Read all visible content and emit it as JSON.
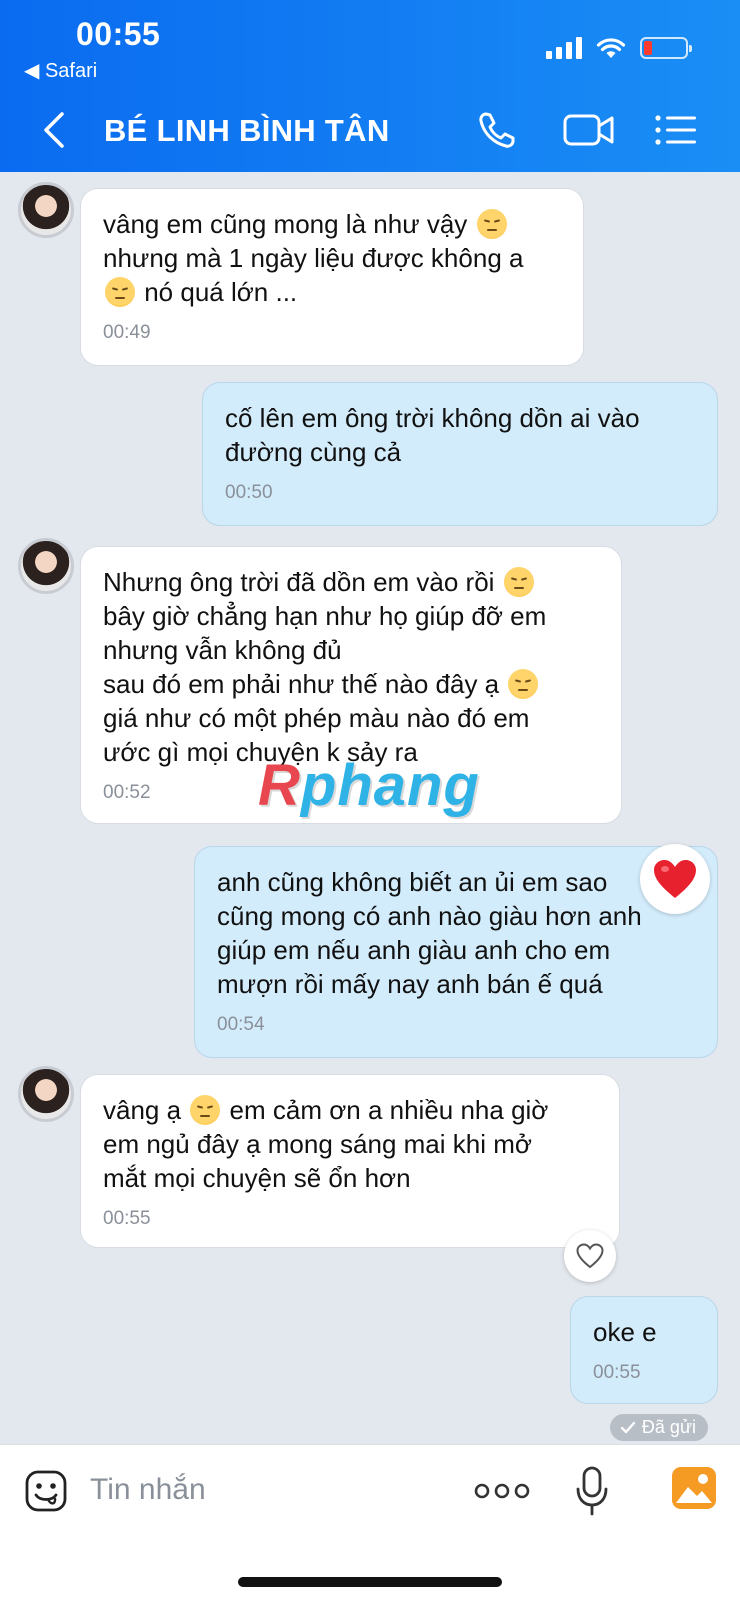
{
  "status_bar": {
    "time": "00:55",
    "back_app": "◀ Safari"
  },
  "header": {
    "contact_name": "BÉ LINH BÌNH TÂN",
    "icons": [
      "back-chevron-icon",
      "phone-icon",
      "video-call-icon",
      "menu-list-icon"
    ]
  },
  "messages": [
    {
      "direction": "in",
      "parts": [
        "vâng em cũng mong là như vậy ",
        "😔",
        "\nnhưng mà 1 ngày liệu được không a\n",
        "😔",
        " nó quá lớn ..."
      ],
      "time": "00:49"
    },
    {
      "direction": "out",
      "parts": [
        "cố lên em ông trời không dồn ai vào\nđường cùng cả"
      ],
      "time": "00:50"
    },
    {
      "direction": "in",
      "parts": [
        "Nhưng ông trời đã dồn em vào rồi ",
        "😔",
        "\nbây giờ chẳng hạn như họ giúp đỡ em\nnhưng vẫn không đủ\nsau đó em phải như thế nào đây ạ ",
        "😔",
        "\ngiá như có một phép màu nào đó em\nước gì mọi chuyện k sảy ra"
      ],
      "time": "00:52"
    },
    {
      "direction": "out",
      "parts": [
        "anh cũng không biết an ủi em sao\ncũng mong có anh nào giàu hơn anh\ngiúp em nếu anh giàu anh cho em\nmượn rồi mấy nay anh bán ế quá"
      ],
      "time": "00:54",
      "reaction": "heart-red"
    },
    {
      "direction": "in",
      "parts": [
        "vâng ạ ",
        "😔",
        " em cảm ơn a nhiều nha giờ\nem ngủ đây ạ mong sáng mai khi mở\nmắt mọi chuyện sẽ ổn hơn"
      ],
      "time": "00:55",
      "reaction": "heart-outline"
    },
    {
      "direction": "out",
      "parts": [
        "oke e"
      ],
      "time": "00:55"
    }
  ],
  "watermark": {
    "r": "R",
    "rest": "phang"
  },
  "sent_status": "Đã gửi",
  "composer": {
    "placeholder": "Tin nhắn",
    "icons": [
      "sticker-icon",
      "more-dots-icon",
      "microphone-icon",
      "image-gallery-icon"
    ]
  },
  "colors": {
    "header_gradient_start": "#0a6bf0",
    "header_gradient_end": "#1a8ef5",
    "incoming_bubble": "#ffffff",
    "outgoing_bubble": "#d3ecfb",
    "background": "#e3e8ee",
    "heart": "#e8212f",
    "gallery_icon": "#f59a23"
  }
}
